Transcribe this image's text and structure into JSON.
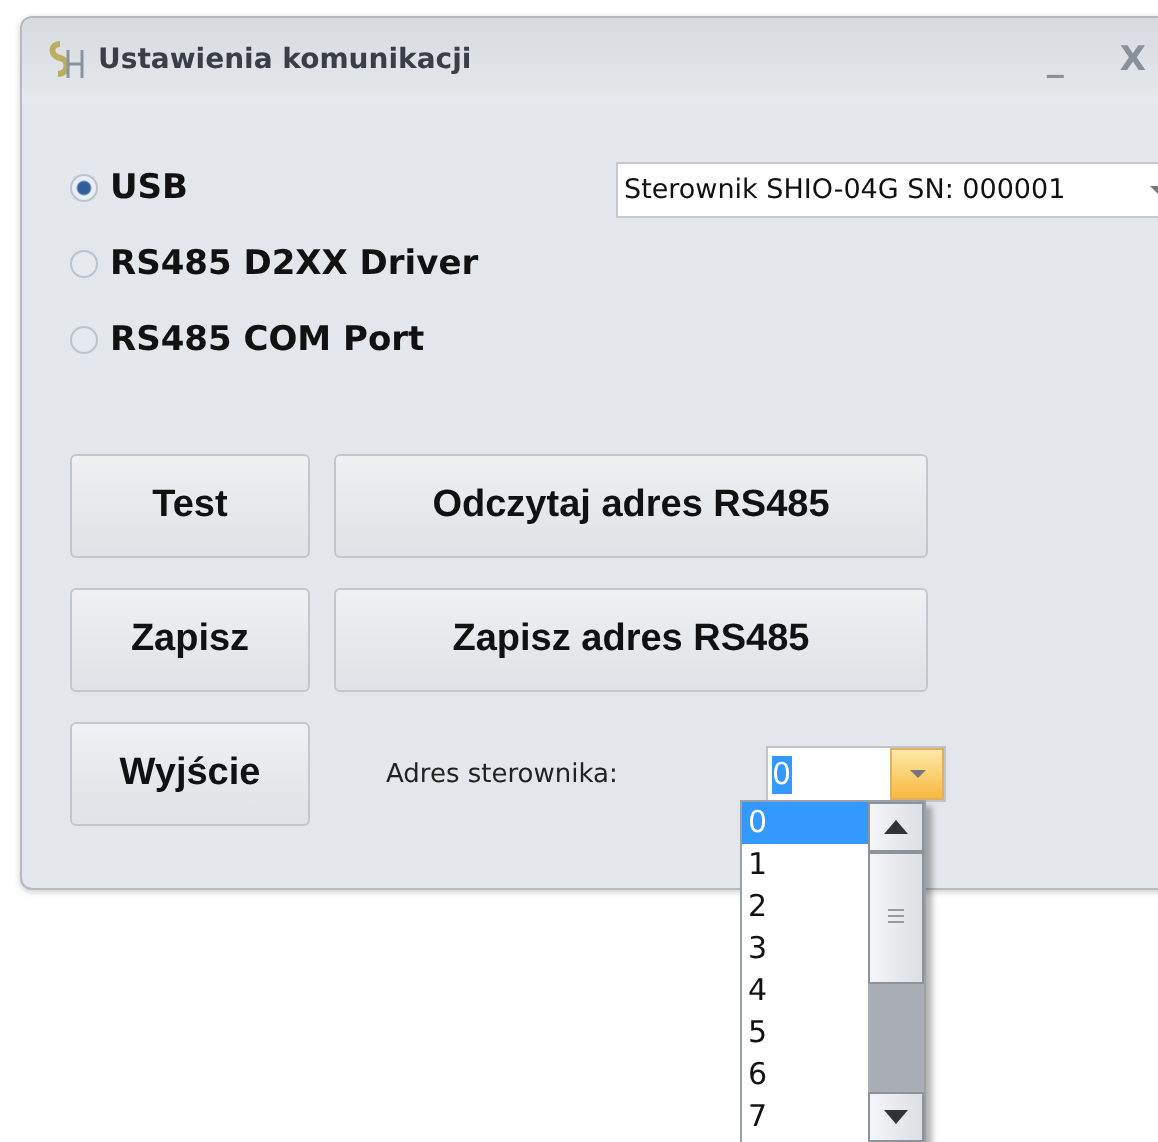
{
  "window": {
    "title": "Ustawienia komunikacji",
    "controls": [
      "_",
      "X"
    ]
  },
  "connections": [
    {
      "label": "USB",
      "selected": true
    },
    {
      "label": "RS485 D2XX Driver",
      "selected": false
    },
    {
      "label": "RS485 COM Port",
      "selected": false
    }
  ],
  "device_select": {
    "value": "Sterownik SHIO-04G SN: 000001"
  },
  "buttons": [
    [
      "Test",
      "Odczytaj adres RS485"
    ],
    [
      "Zapisz",
      "Zapisz adres RS485"
    ],
    [
      "Wyjście"
    ]
  ],
  "address": {
    "label": "Adres sterownika:",
    "value": "0",
    "expanded": true,
    "options": [
      {
        "label": "0",
        "selected": true
      },
      {
        "label": "1",
        "selected": false
      },
      {
        "label": "2",
        "selected": false
      },
      {
        "label": "3",
        "selected": false
      },
      {
        "label": "4",
        "selected": false
      },
      {
        "label": "5",
        "selected": false
      },
      {
        "label": "6",
        "selected": false
      },
      {
        "label": "7",
        "selected": false
      }
    ]
  }
}
